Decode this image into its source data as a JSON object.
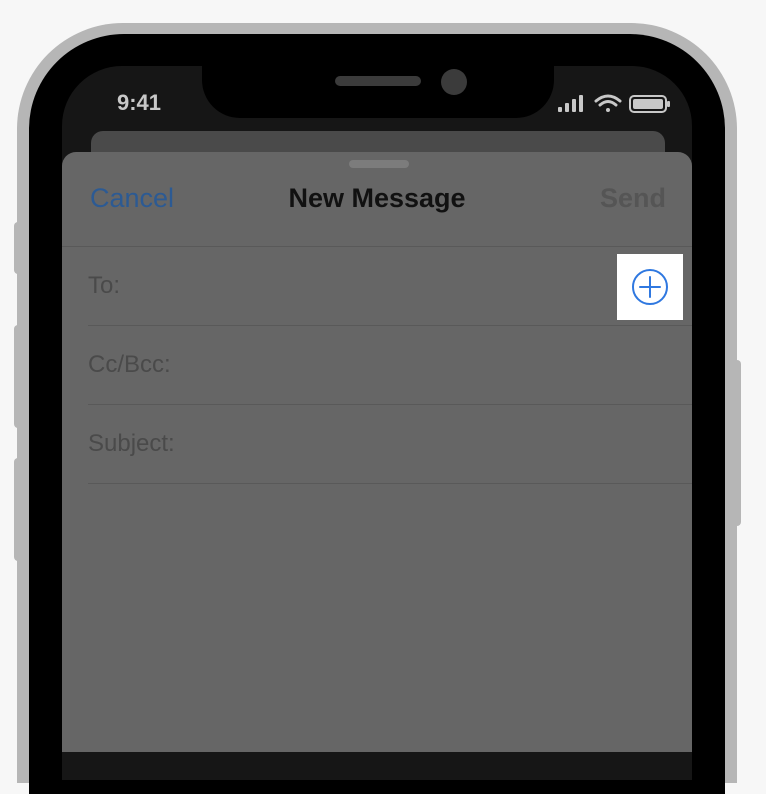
{
  "status_bar": {
    "time": "9:41",
    "signal_icon": "cellular-signal-icon",
    "wifi_icon": "wifi-icon",
    "battery_icon": "battery-icon"
  },
  "compose": {
    "cancel_label": "Cancel",
    "title": "New Message",
    "send_label": "Send",
    "fields": {
      "to": "To:",
      "cc_bcc": "Cc/Bcc:",
      "subject": "Subject:"
    },
    "add_contact_icon": "add-contact-icon"
  },
  "colors": {
    "accent": "#2c5a93",
    "highlight_icon": "#2f78e0",
    "sheet": "#666666"
  }
}
